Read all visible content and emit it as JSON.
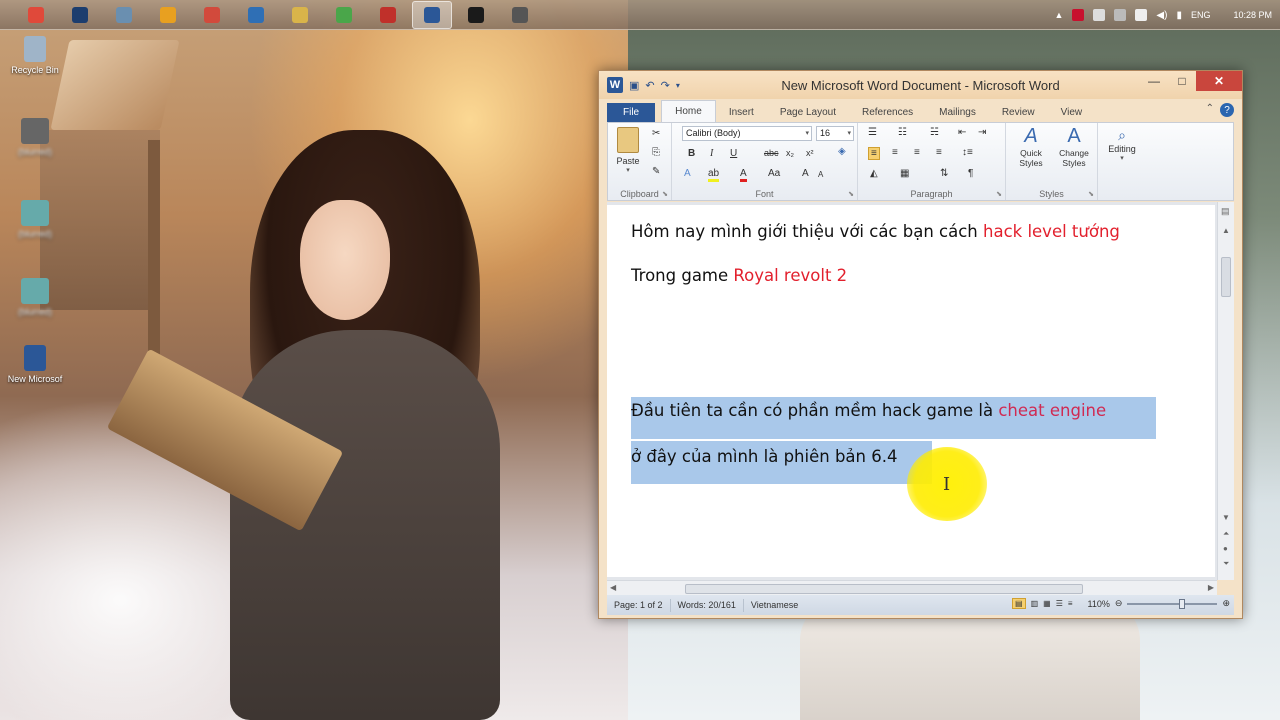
{
  "taskbar": {
    "apps": [
      {
        "name": "chrome-icon",
        "color": "#e0493a"
      },
      {
        "name": "photoshop-icon",
        "color": "#1c3d6e"
      },
      {
        "name": "image-viewer-icon",
        "color": "#6a8fb0"
      },
      {
        "name": "winamp-icon",
        "color": "#e8a020"
      },
      {
        "name": "paint-icon",
        "color": "#d24a3c"
      },
      {
        "name": "globe-icon",
        "color": "#2f6fb5"
      },
      {
        "name": "folder-icon",
        "color": "#d9b44a"
      },
      {
        "name": "utorrent-icon",
        "color": "#4aa64a"
      },
      {
        "name": "app-red-icon",
        "color": "#c0302a"
      },
      {
        "name": "word-icon",
        "color": "#2b5797"
      },
      {
        "name": "euro-icon",
        "color": "#1a1a1a"
      },
      {
        "name": "network-app-icon",
        "color": "#555555"
      }
    ],
    "active_index": 9,
    "tray": {
      "lang": "ENG",
      "time": "10:28 PM"
    }
  },
  "desktop_icons": [
    {
      "label": "Recycle Bin",
      "color": "#9fb4c8"
    },
    {
      "label": "(blurred)",
      "color": "#666666"
    },
    {
      "label": "(blurred)",
      "color": "#66aaaa"
    },
    {
      "label": "(blurred)",
      "color": "#66aaaa"
    },
    {
      "label": "New Microsof",
      "color": "#2b5797"
    }
  ],
  "word": {
    "title": "New Microsoft Word Document - Microsoft Word",
    "tabs": [
      "File",
      "Home",
      "Insert",
      "Page Layout",
      "References",
      "Mailings",
      "Review",
      "View"
    ],
    "active_tab": "Home",
    "ribbon": {
      "clipboard": {
        "label": "Clipboard",
        "paste": "Paste"
      },
      "font": {
        "label": "Font",
        "family": "Calibri (Body)",
        "size": "16"
      },
      "paragraph": {
        "label": "Paragraph"
      },
      "styles": {
        "label": "Styles",
        "quick": "Quick Styles",
        "change": "Change Styles"
      },
      "editing": {
        "label": "Editing"
      }
    },
    "document": {
      "line1_plain": "Hôm nay mình giới thiệu với các bạn cách ",
      "line1_red": "hack level tướng",
      "line2_plain": "Trong game ",
      "line2_red": "Royal revolt 2",
      "line3_plain": "Đầu tiên ta cần có phần mềm hack game là ",
      "line3_red": "cheat engine",
      "line4_plain": "ở đây của mình là phiên bản 6.4"
    },
    "status": {
      "page": "Page: 1 of 2",
      "words": "Words: 20/161",
      "language": "Vietnamese",
      "zoom": "110%"
    }
  }
}
